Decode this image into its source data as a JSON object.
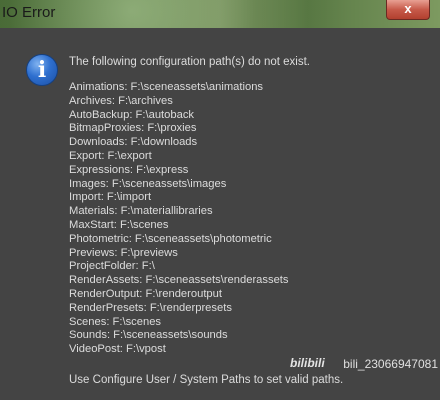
{
  "window": {
    "title": "IO Error",
    "close_label": "x"
  },
  "dialog": {
    "icon": "info-icon",
    "icon_glyph": "i",
    "heading": "The following configuration path(s) do not exist.",
    "paths": [
      "Animations: F:\\sceneassets\\animations",
      "Archives: F:\\archives",
      "AutoBackup: F:\\autoback",
      "BitmapProxies: F:\\proxies",
      "Downloads: F:\\downloads",
      "Export: F:\\export",
      "Expressions: F:\\express",
      "Images: F:\\sceneassets\\images",
      "Import: F:\\import",
      "Materials: F:\\materiallibraries",
      "MaxStart: F:\\scenes",
      "Photometric: F:\\sceneassets\\photometric",
      "Previews: F:\\previews",
      "ProjectFolder: F:\\",
      "RenderAssets: F:\\sceneassets\\renderassets",
      "RenderOutput: F:\\renderoutput",
      "RenderPresets: F:\\renderpresets",
      "Scenes: F:\\scenes",
      "Sounds: F:\\sceneassets\\sounds",
      "VideoPost: F:\\vpost"
    ],
    "footer": "Use Configure User / System Paths to set valid paths."
  },
  "watermark": {
    "logo": "bilibili",
    "text": "bili_23066947081"
  },
  "colors": {
    "background": "#444444",
    "text": "#dcdcdc",
    "close_button": "#c75a4a",
    "info_icon": "#2e6fcf"
  }
}
